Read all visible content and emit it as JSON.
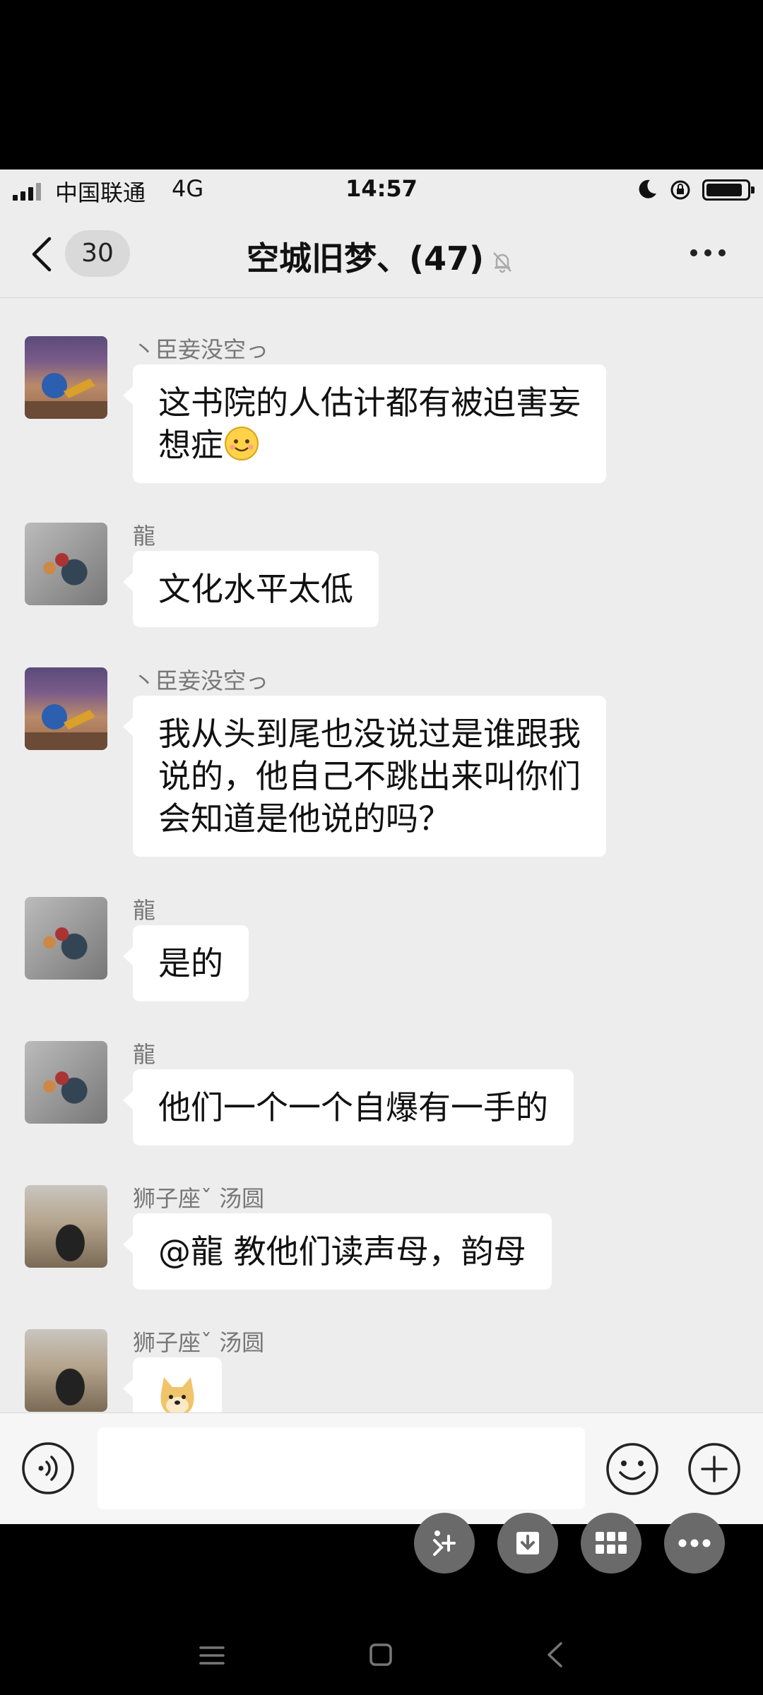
{
  "status_bar": {
    "carrier": "中国联通",
    "network": "4G",
    "time": "14:57"
  },
  "header": {
    "unread_count": "30",
    "title": "空城旧梦、(47)"
  },
  "messages": [
    {
      "sender": "丶臣妾没空っ",
      "avatar": "ball-photo-avatar",
      "lines": [
        "这书院的人估计都有被迫害妄",
        "想症"
      ],
      "emoji": "smile-emoji"
    },
    {
      "sender": "龍",
      "avatar": "flower-avatar",
      "lines": [
        "文化水平太低"
      ]
    },
    {
      "sender": "丶臣妾没空っ",
      "avatar": "ball-photo-avatar",
      "lines": [
        "我从头到尾也没说过是谁跟我",
        "说的，他自己不跳出来叫你们",
        "会知道是他说的吗？"
      ]
    },
    {
      "sender": "龍",
      "avatar": "flower-avatar",
      "lines": [
        "是的"
      ]
    },
    {
      "sender": "龍",
      "avatar": "flower-avatar",
      "lines": [
        "他们一个一个自爆有一手的"
      ]
    },
    {
      "sender": "狮子座ˇ 汤圆",
      "avatar": "park-photo-avatar",
      "lines": [
        "@龍 教他们读声母，韵母"
      ]
    },
    {
      "sender": "狮子座ˇ 汤圆",
      "avatar": "park-photo-avatar",
      "sticker": "doge-sticker"
    }
  ],
  "input": {
    "value": "",
    "placeholder": ""
  },
  "colors": {
    "chat_background": "#ededed",
    "bubble": "#ffffff",
    "sender_text": "#777777"
  }
}
